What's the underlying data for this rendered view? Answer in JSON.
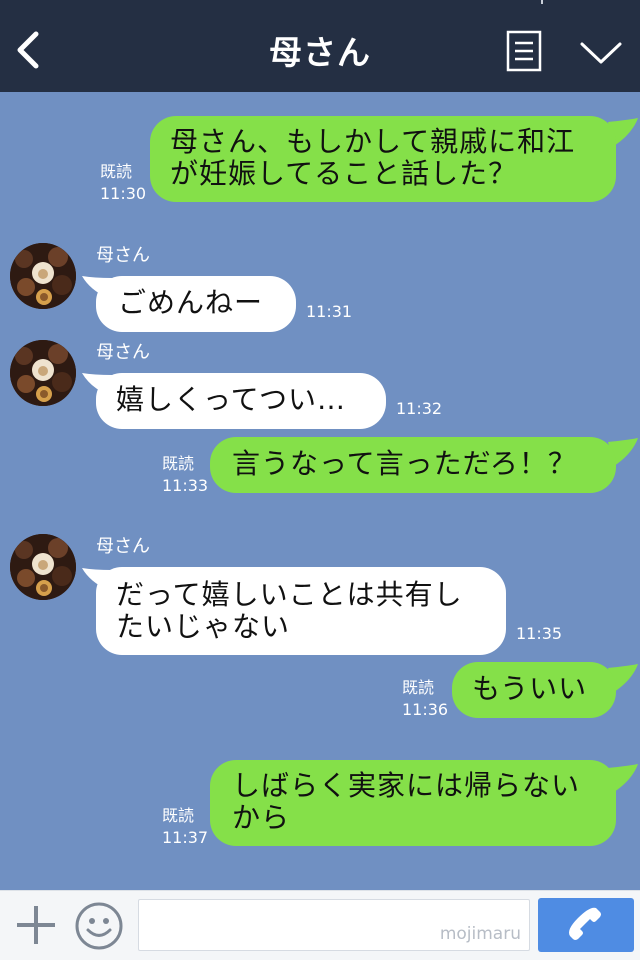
{
  "header": {
    "title": "母さん",
    "back_icon": "chevron-left-icon",
    "menu_icon": "list-icon",
    "collapse_icon": "chevron-down-icon",
    "background": "#242f43"
  },
  "colors": {
    "chat_background": "#7090c2",
    "sent_bubble": "#85e049",
    "received_bubble": "#ffffff",
    "call_button": "#4f8ce3"
  },
  "messages": [
    {
      "side": "right",
      "lines": [
        "母さん、もしかして親戚に和江",
        "が妊娠してること話した？"
      ],
      "read": "既読",
      "time": "11:30"
    },
    {
      "side": "left",
      "sender": "母さん",
      "lines": [
        "ごめんねー"
      ],
      "time": "11:31"
    },
    {
      "side": "left",
      "sender": "母さん",
      "lines": [
        "嬉しくってつい…"
      ],
      "time": "11:32"
    },
    {
      "side": "right",
      "lines": [
        "言うなって言っただろ！？"
      ],
      "read": "既読",
      "time": "11:33"
    },
    {
      "side": "left",
      "sender": "母さん",
      "lines": [
        "だって嬉しいことは共有し",
        "たいじゃない"
      ],
      "time": "11:35"
    },
    {
      "side": "right",
      "lines": [
        "もういい"
      ],
      "read": "既読",
      "time": "11:36"
    },
    {
      "side": "right",
      "lines": [
        "しばらく実家には帰らない",
        "から"
      ],
      "read": "既読",
      "time": "11:37"
    }
  ],
  "footer": {
    "plus_icon": "plus-icon",
    "sticker_icon": "smiley-icon",
    "input_value": "",
    "watermark": "mojimaru",
    "call_icon": "phone-icon"
  }
}
